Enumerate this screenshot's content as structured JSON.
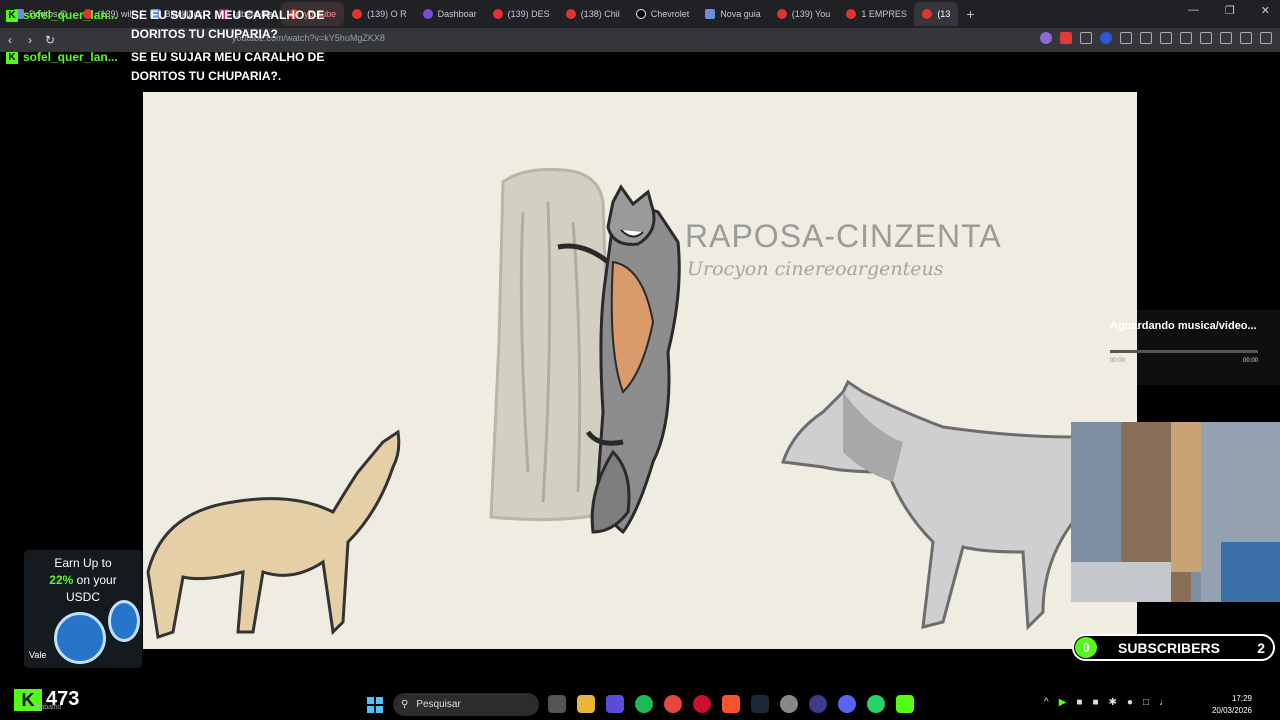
{
  "browser": {
    "tabs": [
      {
        "label": "Doritos C",
        "icon": "chrome-icon"
      },
      {
        "label": "(139) will",
        "icon": "youtube-icon"
      },
      {
        "label": "Blackjack",
        "icon": "blackjack-icon"
      },
      {
        "label": "tabela-bla",
        "icon": "magenta-icon"
      },
      {
        "label": "youtube",
        "icon": "youtube-icon"
      },
      {
        "label": "(139) O R",
        "icon": "youtube-icon"
      },
      {
        "label": "Dashboar",
        "icon": "purple-icon"
      },
      {
        "label": "(139) DES",
        "icon": "youtube-icon"
      },
      {
        "label": "(138) Chil",
        "icon": "youtube-icon"
      },
      {
        "label": "Chevrolet",
        "icon": "tiktok-icon"
      },
      {
        "label": "Nova guia",
        "icon": "shield-icon"
      },
      {
        "label": "(139) You",
        "icon": "youtube-icon"
      },
      {
        "label": "1 EMPRES",
        "icon": "youtube-icon"
      },
      {
        "label": "(13",
        "icon": "youtube-icon"
      }
    ],
    "new_tab": "+",
    "url": "youtube.com/watch?v=kY5huMgZKX8"
  },
  "chat": [
    {
      "user": "sofel_quer_lan...",
      "message": "SE EU SUJAR MEU CARALHO DE DORITOS TU CHUPARIA?"
    },
    {
      "user": "sofel_quer_lan...",
      "message": "SE EU SUJAR MEU CARALHO DE DORITOS TU CHUPARIA?."
    }
  ],
  "video": {
    "title": "RAPOSA-CINZENTA",
    "subtitle": "Urocyon cinereoargenteus"
  },
  "music_widget": {
    "status": "Aguardando musica/video...",
    "time_start": "00:00",
    "time_end": "00:00"
  },
  "ad": {
    "line1": "Earn Up to",
    "highlight": "22%",
    "line2_rest": " on your",
    "line3": "USDC",
    "cta": "Vale"
  },
  "viewers": {
    "count": "473",
    "sub": "Trabalho"
  },
  "subscribers": {
    "left_value": "0",
    "label": "SUBSCRIBERS",
    "right_value": "2"
  },
  "taskbar": {
    "search_placeholder": "Pesquisar",
    "time": "17:29",
    "date": "20/03/2026"
  },
  "colors": {
    "kick_green": "#53fc18",
    "video_bg": "#efece1",
    "title_grey": "#9b9b9b"
  }
}
